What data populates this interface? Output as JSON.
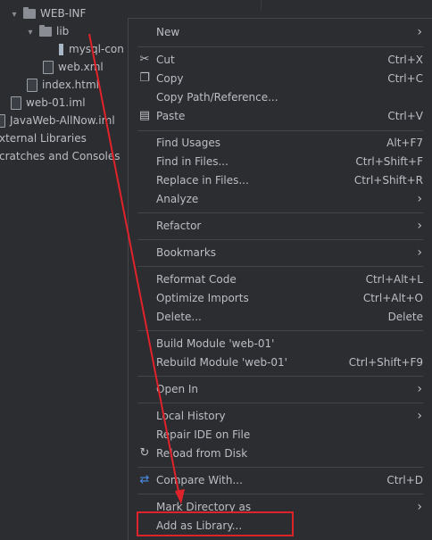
{
  "tree": {
    "items": [
      {
        "label": "WEB-INF",
        "kind": "folder"
      },
      {
        "label": "lib",
        "kind": "folder"
      },
      {
        "label": "mysql-con",
        "kind": "jar"
      },
      {
        "label": "web.xml",
        "kind": "file"
      },
      {
        "label": "index.html",
        "kind": "file"
      },
      {
        "label": "web-01.iml",
        "kind": "file"
      },
      {
        "label": "JavaWeb-AllNow.iml",
        "kind": "file"
      },
      {
        "label": "xternal Libraries",
        "kind": "text"
      },
      {
        "label": "cratches and Consoles",
        "kind": "text"
      }
    ]
  },
  "menu": {
    "items": [
      {
        "label": "New",
        "submenu": true
      },
      {
        "label": "Cut",
        "shortcut": "Ctrl+X",
        "icon": "scissors-icon"
      },
      {
        "label": "Copy",
        "shortcut": "Ctrl+C",
        "icon": "copy-icon"
      },
      {
        "label": "Copy Path/Reference..."
      },
      {
        "label": "Paste",
        "shortcut": "Ctrl+V",
        "icon": "paste-icon"
      },
      {
        "label": "Find Usages",
        "shortcut": "Alt+F7"
      },
      {
        "label": "Find in Files...",
        "shortcut": "Ctrl+Shift+F"
      },
      {
        "label": "Replace in Files...",
        "shortcut": "Ctrl+Shift+R"
      },
      {
        "label": "Analyze",
        "submenu": true
      },
      {
        "label": "Refactor",
        "submenu": true
      },
      {
        "label": "Bookmarks",
        "submenu": true
      },
      {
        "label": "Reformat Code",
        "shortcut": "Ctrl+Alt+L"
      },
      {
        "label": "Optimize Imports",
        "shortcut": "Ctrl+Alt+O"
      },
      {
        "label": "Delete...",
        "shortcut": "Delete"
      },
      {
        "label": "Build Module 'web-01'"
      },
      {
        "label": "Rebuild Module 'web-01'",
        "shortcut": "Ctrl+Shift+F9"
      },
      {
        "label": "Open In",
        "submenu": true
      },
      {
        "label": "Local History",
        "submenu": true
      },
      {
        "label": "Repair IDE on File"
      },
      {
        "label": "Reload from Disk",
        "icon": "reload-icon"
      },
      {
        "label": "Compare With...",
        "shortcut": "Ctrl+D",
        "icon": "compare-icon"
      },
      {
        "label": "Mark Directory as",
        "submenu": true
      },
      {
        "label": "Add as Library..."
      }
    ]
  },
  "annotation": {
    "color": "#e0232b"
  }
}
